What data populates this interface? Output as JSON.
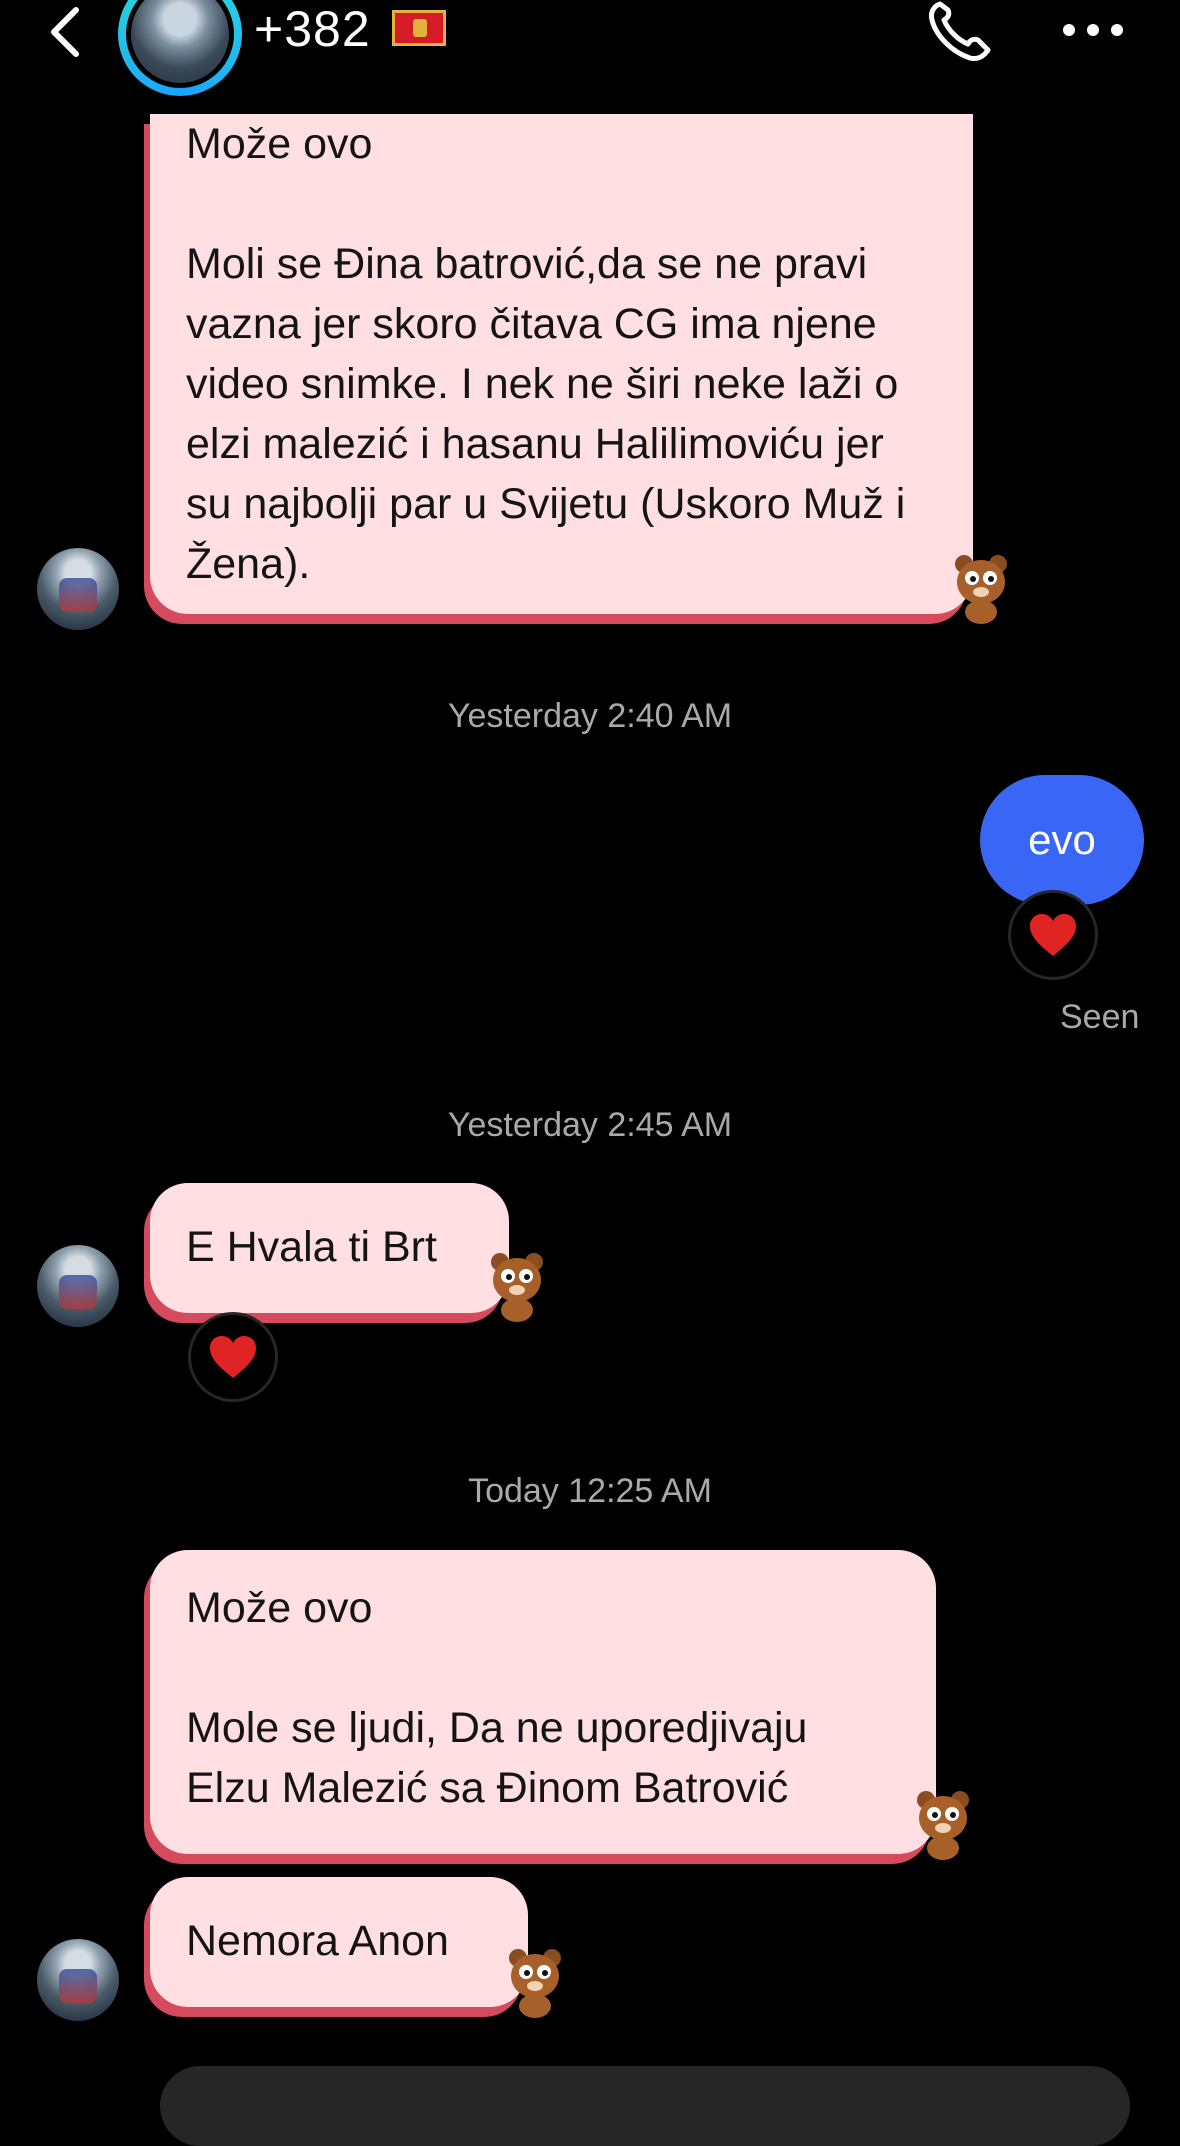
{
  "header": {
    "contact_name": "+382",
    "flag_icon": "montenegro-flag-icon"
  },
  "messages": {
    "m1": {
      "text": "Može ovo\n\nMoli se Đina batrović,da se ne pravi vazna jer skoro čitava CG ima njene video snimke. I nek ne širi neke laži o elzi malezić i hasanu Halilimoviću jer su najbolji par u Svijetu (Uskoro Muž i Žena)."
    },
    "t1": {
      "text": "Yesterday 2:40 AM"
    },
    "m2": {
      "text": "evo",
      "reaction": "❤️",
      "status": "Seen"
    },
    "t2": {
      "text": "Yesterday 2:45 AM"
    },
    "m3": {
      "text": "E Hvala ti Brt",
      "reaction": "❤️"
    },
    "t3": {
      "text": "Today 12:25 AM"
    },
    "m4": {
      "text": "Može ovo\n\nMole se ljudi, Da ne uporedjivaju Elzu Malezić sa Đinom Batrović"
    },
    "m5": {
      "text": "Nemora Anon"
    }
  },
  "colors": {
    "incoming_bubble": "#ffdfe2",
    "outgoing_bubble": "#3a66f5",
    "accent_shadow": "#d54a5c"
  }
}
